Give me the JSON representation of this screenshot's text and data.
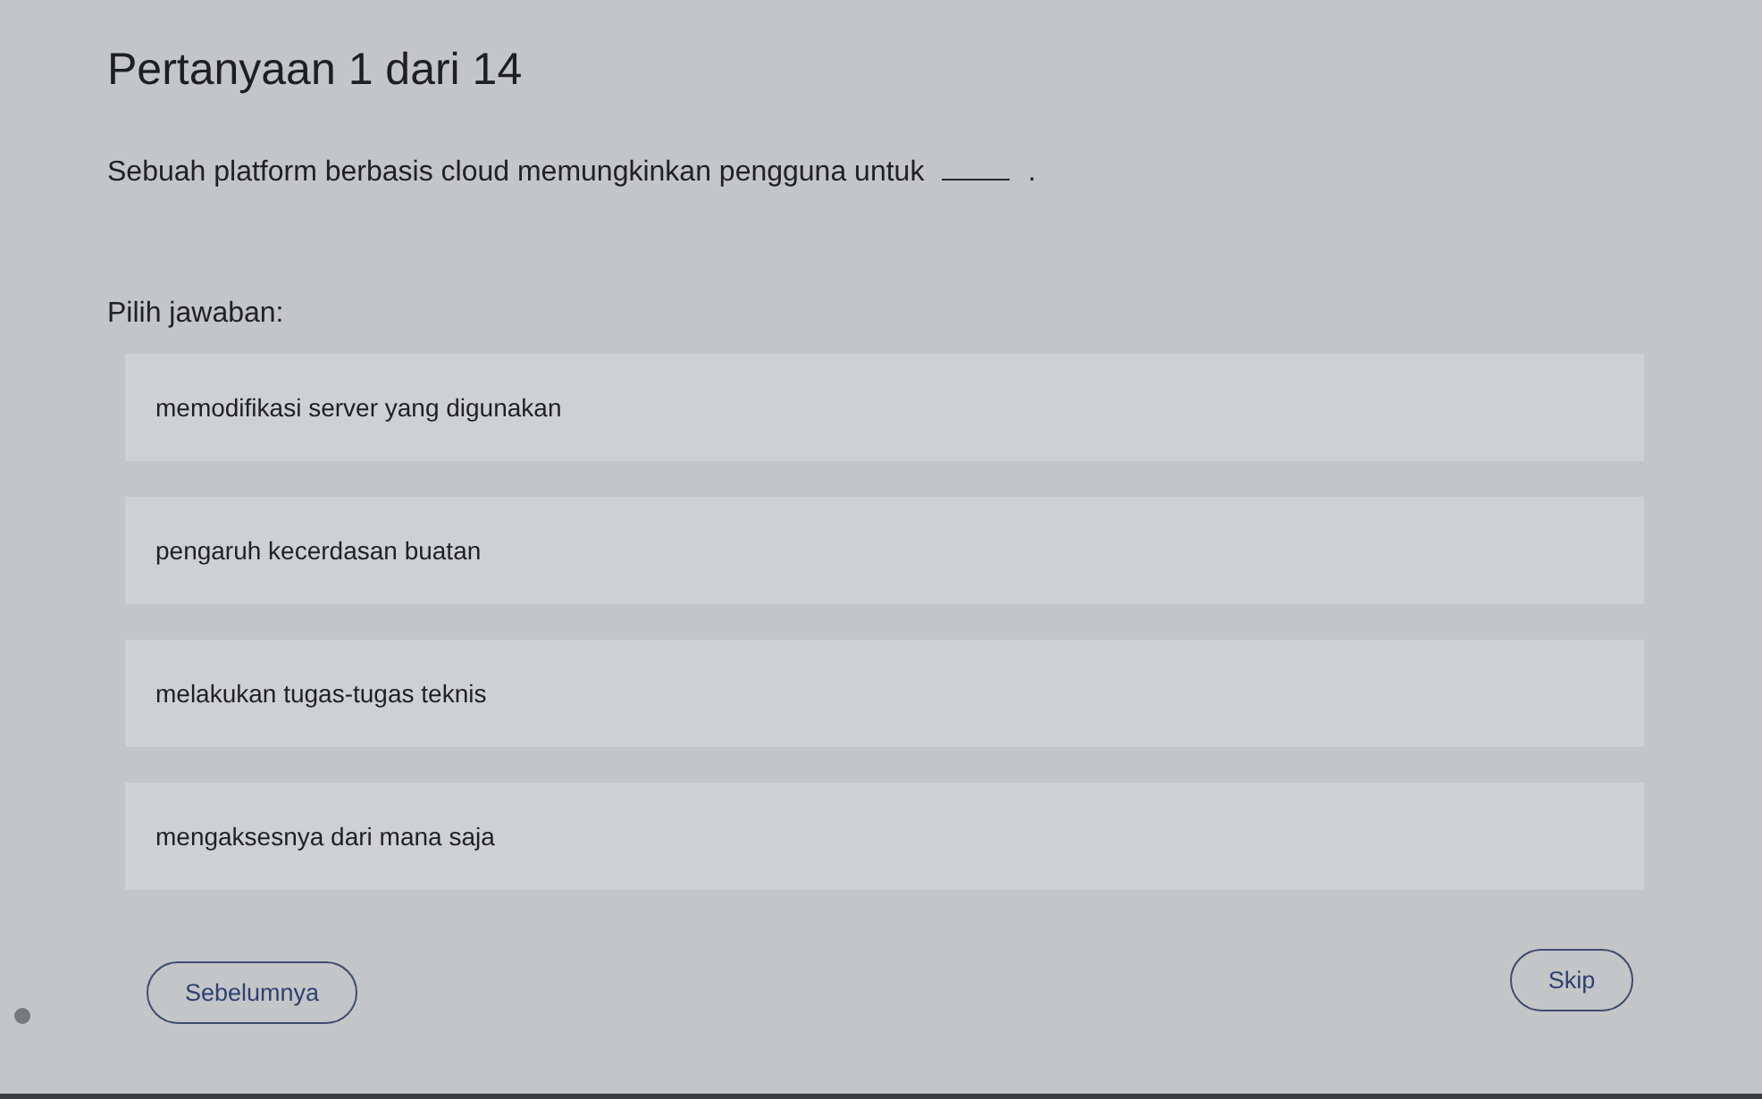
{
  "title": "Pertanyaan 1 dari 14",
  "question": {
    "text_before": "Sebuah platform berbasis cloud memungkinkan pengguna untuk",
    "text_after": "."
  },
  "prompt": "Pilih jawaban:",
  "options": [
    {
      "label": "memodifikasi server yang digunakan",
      "selected": false
    },
    {
      "label": "pengaruh kecerdasan buatan",
      "selected": false
    },
    {
      "label": "melakukan tugas-tugas teknis",
      "selected": false
    },
    {
      "label": "mengaksesnya dari mana saja",
      "selected": false
    }
  ],
  "buttons": [
    {
      "kind": "previous",
      "label": "Sebelumnya"
    },
    {
      "kind": "skip",
      "label": "Skip"
    }
  ]
}
